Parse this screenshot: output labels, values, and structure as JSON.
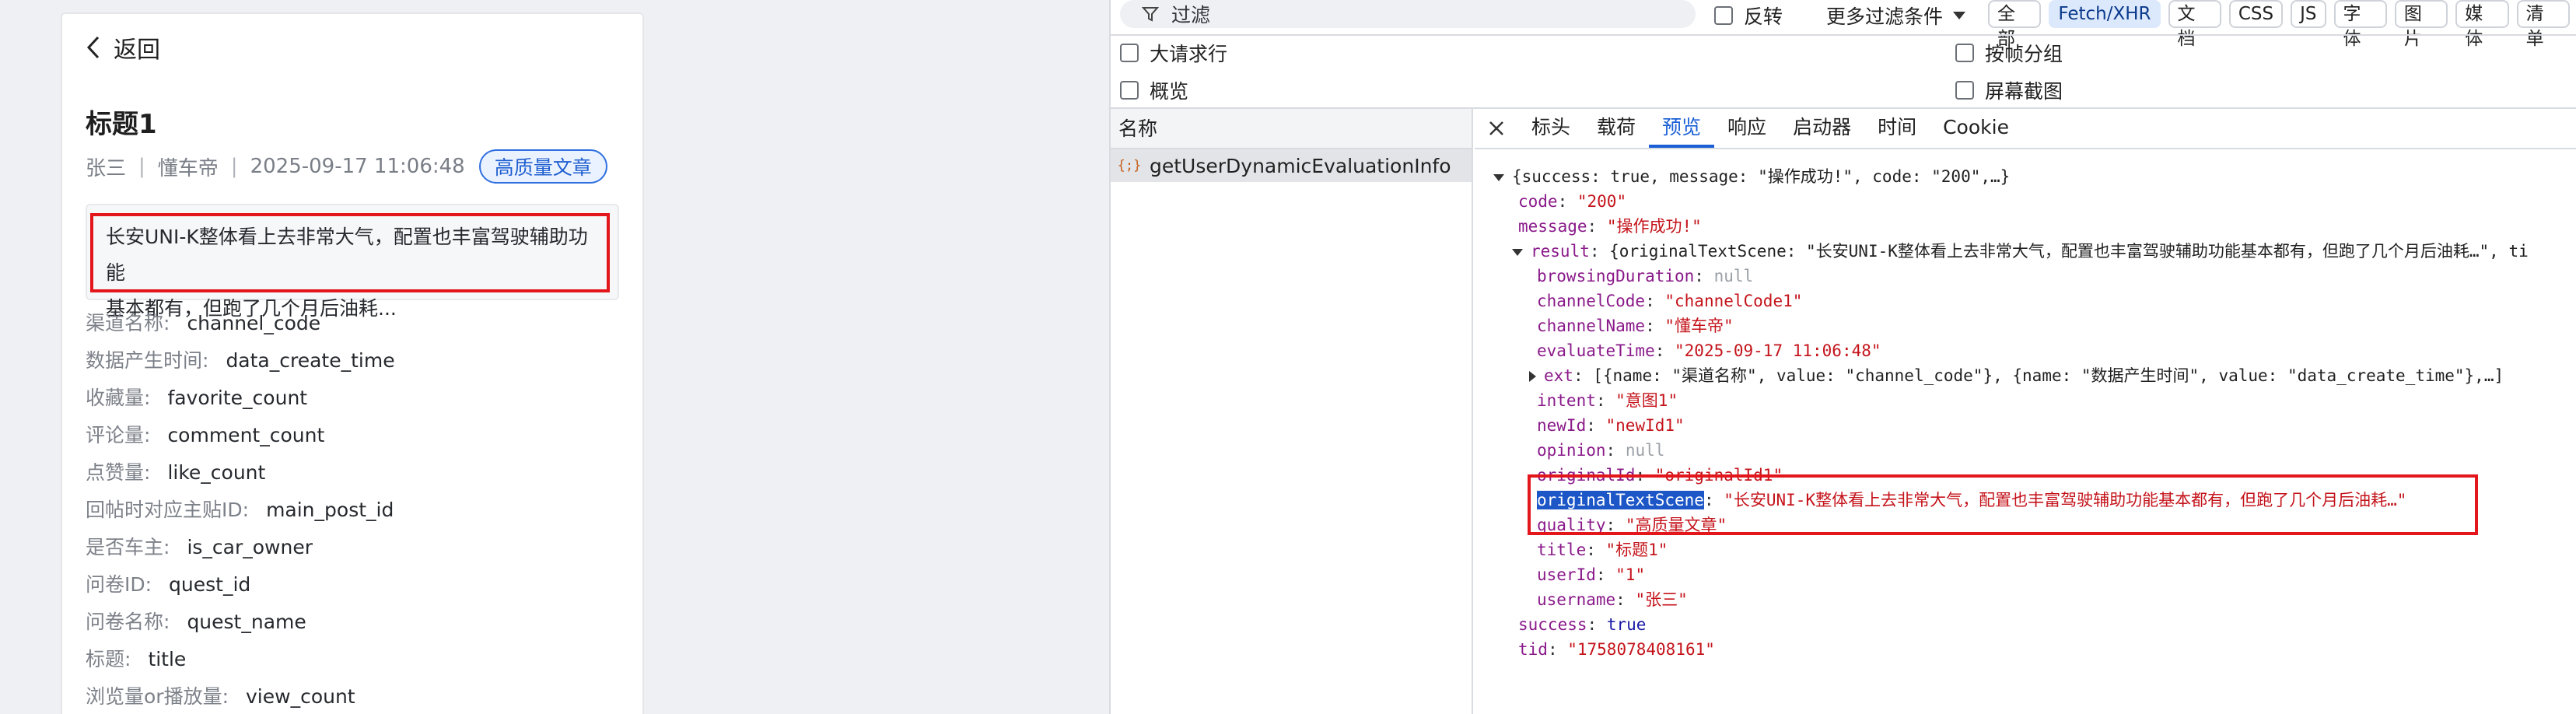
{
  "article": {
    "back_label": "返回",
    "title": "标题1",
    "author": "张三",
    "channel": "懂车帝",
    "datetime": "2025-09-17 11:06:48",
    "quality_badge": "高质量文章",
    "summary_line1": "长安UNI-K整体看上去非常大气，配置也丰富驾驶辅助功能",
    "summary_line2": "基本都有，但跑了几个月后油耗...",
    "fields": [
      {
        "key": "渠道名称:",
        "value": "channel_code"
      },
      {
        "key": "数据产生时间:",
        "value": "data_create_time"
      },
      {
        "key": "收藏量:",
        "value": "favorite_count"
      },
      {
        "key": "评论量:",
        "value": "comment_count"
      },
      {
        "key": "点赞量:",
        "value": "like_count"
      },
      {
        "key": "回帖时对应主贴ID:",
        "value": "main_post_id"
      },
      {
        "key": "是否车主:",
        "value": "is_car_owner"
      },
      {
        "key": "问卷ID:",
        "value": "quest_id"
      },
      {
        "key": "问卷名称:",
        "value": "quest_name"
      },
      {
        "key": "标题:",
        "value": "title"
      },
      {
        "key": "浏览量or播放量:",
        "value": "view_count"
      }
    ]
  },
  "devtools": {
    "filter_placeholder": "过滤",
    "invert_label": "反转",
    "more_filters_label": "更多过滤条件",
    "type_filters": [
      "全部",
      "Fetch/XHR",
      "文档",
      "CSS",
      "JS",
      "字体",
      "图片",
      "媒体",
      "清单"
    ],
    "active_type_filter": "Fetch/XHR",
    "options": {
      "big_rows": "大请求行",
      "overview": "概览",
      "group_by_frame": "按帧分组",
      "screenshots": "屏幕截图"
    },
    "name_header": "名称",
    "request_name": "getUserDynamicEvaluationInfo",
    "request_icon": "{;}",
    "detail_tabs": [
      "标头",
      "载荷",
      "预览",
      "响应",
      "启动器",
      "时间",
      "Cookie"
    ],
    "active_tab": "预览",
    "preview": {
      "root_summary": "{success: true, message: \"操作成功!\", code: \"200\",…}",
      "code_key": "code",
      "code_val": "\"200\"",
      "message_key": "message",
      "message_val": "\"操作成功!\"",
      "result_key": "result",
      "result_summary": "{originalTextScene: \"长安UNI-K整体看上去非常大气，配置也丰富驾驶辅助功能基本都有，但跑了几个月后油耗…\", ti",
      "browsing_key": "browsingDuration",
      "browsing_val": "null",
      "channelCode_key": "channelCode",
      "channelCode_val": "\"channelCode1\"",
      "channelName_key": "channelName",
      "channelName_val": "\"懂车帝\"",
      "evaluateTime_key": "evaluateTime",
      "evaluateTime_val": "\"2025-09-17 11:06:48\"",
      "ext_key": "ext",
      "ext_summary": "[{name: \"渠道名称\", value: \"channel_code\"}, {name: \"数据产生时间\", value: \"data_create_time\"},…]",
      "intent_key": "intent",
      "intent_val": "\"意图1\"",
      "newId_key": "newId",
      "newId_val": "\"newId1\"",
      "opinion_key": "opinion",
      "opinion_val": "null",
      "originalId_key": "originalId",
      "originalId_val": "\"originalId1\"",
      "originalTextScene_key": "originalTextScene",
      "originalTextScene_val": "\"长安UNI-K整体看上去非常大气，配置也丰富驾驶辅助功能基本都有，但跑了几个月后油耗…\"",
      "quality_key": "quality",
      "quality_val": "\"高质量文章\"",
      "title_key": "title",
      "title_val": "\"标题1\"",
      "userId_key": "userId",
      "userId_val": "\"1\"",
      "username_key": "username",
      "username_val": "\"张三\"",
      "success_key": "success",
      "success_val": "true",
      "tid_key": "tid",
      "tid_val": "\"1758078408161\""
    }
  },
  "colors": {
    "highlight_border": "#e2161b",
    "accent_blue": "#1a5fd6",
    "json_key": "#8a1a8a",
    "json_string": "#c4141b"
  }
}
